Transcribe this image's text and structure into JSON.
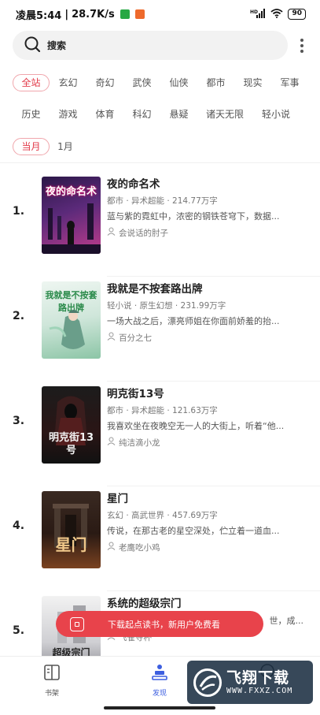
{
  "status_bar": {
    "time": "凌晨5:44",
    "speed": "28.7K/s",
    "network": "HD",
    "battery": "90",
    "colors": {
      "green_badge": "#27a844",
      "orange_badge": "#ee6a2c"
    }
  },
  "search": {
    "label": "搜索"
  },
  "categories": {
    "row1": [
      "全站",
      "玄幻",
      "奇幻",
      "武侠",
      "仙侠",
      "都市",
      "现实",
      "军事"
    ],
    "row2": [
      "历史",
      "游戏",
      "体育",
      "科幻",
      "悬疑",
      "诸天无限",
      "轻小说"
    ],
    "active_index": 0
  },
  "time_filter": {
    "active": "当月",
    "other": "1月"
  },
  "books": [
    {
      "rank": "1.",
      "title": "夜的命名术",
      "meta": "都市 · 异术超能 · 214.77万字",
      "desc": "蓝与紫的霓虹中，浓密的钢铁苍穹下，数据...",
      "author": "会说话的肘子",
      "cover_text": "夜的命名术",
      "cover_colors": [
        "#3b1c5c",
        "#c03d8c"
      ]
    },
    {
      "rank": "2.",
      "title": "我就是不按套路出牌",
      "meta": "轻小说 · 原生幻想 · 231.99万字",
      "desc": "一场大战之后，漂亮师姐在你面前娇羞的抬...",
      "author": "百分之七",
      "cover_text": "我就是不按套路出牌",
      "cover_colors": [
        "#d8ebe4",
        "#7bbf9a"
      ]
    },
    {
      "rank": "3.",
      "title": "明克街13号",
      "meta": "都市 · 异术超能 · 121.63万字",
      "desc": "我喜欢坐在夜晚空无一人的大街上，听着“他...",
      "author": "纯洁滴小龙",
      "cover_text": "明克街13号",
      "cover_colors": [
        "#111111",
        "#5a2424"
      ]
    },
    {
      "rank": "4.",
      "title": "星门",
      "meta": "玄幻 · 高武世界 · 457.69万字",
      "desc": "传说，在那古老的星空深处，伫立着一道血...",
      "author": "老鹰吃小鸡",
      "cover_text": "星门",
      "cover_colors": [
        "#2a1a14",
        "#9c5a2b"
      ]
    },
    {
      "rank": "5.",
      "title": "系统的超级宗门",
      "meta": "",
      "desc": "世，成...",
      "author": "飞雀夺杯",
      "cover_text": "超级宗门",
      "cover_colors": [
        "#e9e9ea",
        "#9a9a9e"
      ]
    }
  ],
  "banner": {
    "text": "下载起点读书，新用户免费看"
  },
  "tabs": {
    "bookshelf": "书架",
    "discover": "发现"
  },
  "watermark": {
    "title": "飞翔下载",
    "sub": "WWW.FXXZ.COM"
  },
  "colors": {
    "accent": "#e23b4a",
    "tab_active": "#3d5fe0",
    "banner": "#e8434b"
  }
}
